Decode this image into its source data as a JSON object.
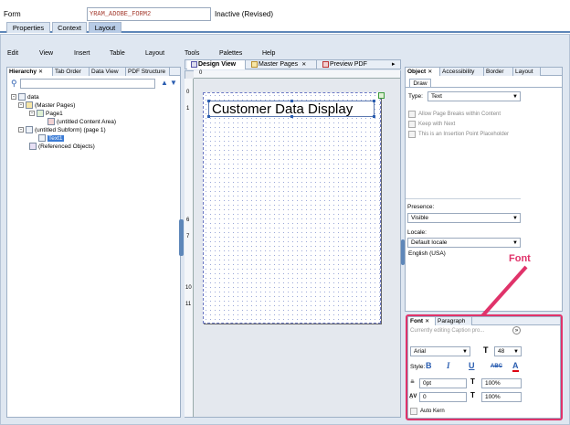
{
  "header": {
    "form_label": "Form",
    "form_name": "YRAM_ADOBE_FORM2",
    "status": "Inactive (Revised)"
  },
  "top_tabs": [
    {
      "label": "Properties"
    },
    {
      "label": "Context"
    },
    {
      "label": "Layout"
    }
  ],
  "menu": [
    "Edit",
    "View",
    "Insert",
    "Table",
    "Layout",
    "Tools",
    "Palettes",
    "Help"
  ],
  "hierarchy": {
    "tabs": [
      "Hierarchy",
      "Tab Order",
      "Data View",
      "PDF Structure"
    ],
    "tree": [
      {
        "label": "data"
      },
      {
        "label": "(Master Pages)"
      },
      {
        "label": "Page1"
      },
      {
        "label": "(untitled Content Area)"
      },
      {
        "label": "(untitled Subform) (page 1)"
      },
      {
        "label": "Text1"
      },
      {
        "label": "(Referenced Objects)"
      }
    ]
  },
  "designer": {
    "tabs": [
      "Design View",
      "Master Pages",
      "Preview PDF"
    ],
    "textbox_text": "Customer Data Display",
    "ruler_top": "0",
    "ruler_left": [
      "0",
      "1",
      "6",
      "7",
      "10",
      "11"
    ]
  },
  "object_panel": {
    "tabs": [
      "Object",
      "Accessibility",
      "Border",
      "Layout"
    ],
    "subtab": "Draw",
    "type_label": "Type:",
    "type_value": "Text",
    "checks": [
      "Allow Page Breaks within Content",
      "Keep with Next",
      "This is an Insertion Point Placeholder"
    ],
    "presence_label": "Presence:",
    "presence_value": "Visible",
    "locale_label": "Locale:",
    "locale_value": "Default locale",
    "locale_sub": "English (USA)"
  },
  "font_panel": {
    "tabs": [
      "Font",
      "Paragraph"
    ],
    "editing_label": "Currently editing Caption pro...",
    "font_value": "Arial",
    "size_value": "48",
    "style_label": "Style:",
    "bold": "B",
    "italic": "I",
    "underline": "U",
    "strike": "ABC",
    "color": "A",
    "baseline_value": "0pt",
    "hscale_value": "100%",
    "kern_value": "0",
    "vscale_value": "100%",
    "auto_kern": "Auto Kern"
  },
  "annotation": {
    "label": "Font",
    "color": "#e0336a"
  }
}
